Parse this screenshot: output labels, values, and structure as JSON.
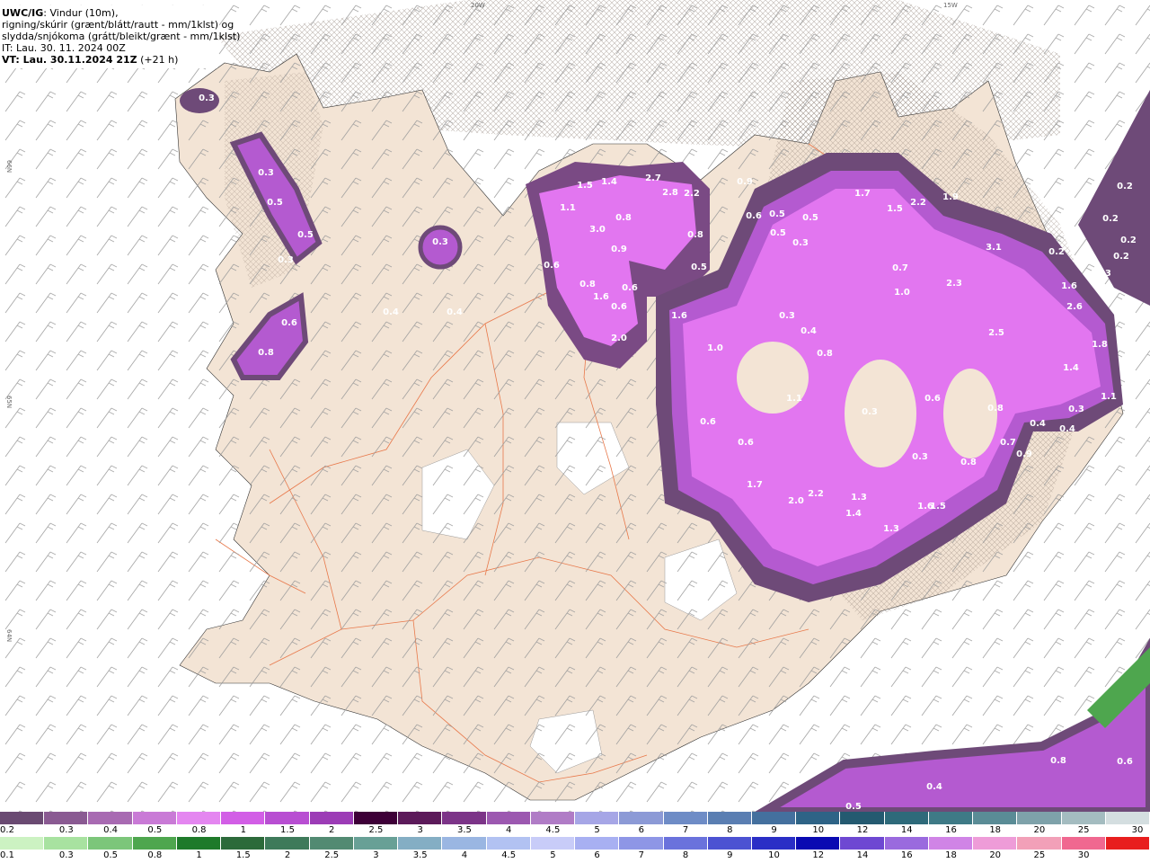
{
  "header": {
    "model": "UWC/IG",
    "desc1": ": Vindur (10m),",
    "desc2": "rigning/skúrir (grænt/blátt/rautt - mm/1klst) og",
    "desc3": "slydda/snjókoma (grátt/bleikt/grænt - mm/1klst)",
    "it": "IT: Lau. 30. 11. 2024 00Z",
    "vt_main": "VT: Lau. 30.11.2024 21Z",
    "vt_offset": "(+21 h)"
  },
  "map": {
    "grid_labels": [
      "20W",
      "15W",
      "66N",
      "65N",
      "64N"
    ],
    "precip_labels": [
      "0.3",
      "0.3",
      "0.5",
      "0.5",
      "0.3",
      "0.3",
      "0.6",
      "0.8",
      "0.4",
      "0.4",
      "1.5",
      "1.4",
      "1.1",
      "3.0",
      "2.7",
      "2.8",
      "2.2",
      "0.8",
      "0.9",
      "0.8",
      "0.5",
      "0.6",
      "0.8",
      "1.6",
      "0.6",
      "0.6",
      "2.0",
      "0.9",
      "0.6",
      "0.5",
      "0.5",
      "0.5",
      "0.3",
      "1.7",
      "1.5",
      "2.2",
      "1.9",
      "0.7",
      "1.0",
      "2.3",
      "3.1",
      "2.5",
      "1.6",
      "2.6",
      "1.8",
      "1.4",
      "1.1",
      "0.3",
      "0.4",
      "0.4",
      "0.2",
      "0.2",
      "0.2",
      "0.2",
      "0.2",
      "0.3",
      "1.6",
      "1.0",
      "0.3",
      "0.4",
      "0.8",
      "1.1",
      "0.6",
      "0.6",
      "0.3",
      "0.6",
      "0.8",
      "0.7",
      "0.8",
      "0.9",
      "0.3",
      "1.7",
      "2.0",
      "2.2",
      "1.3",
      "1.4",
      "1.6",
      "1.5",
      "1.3",
      "0.8",
      "0.6",
      "0.4",
      "0.5"
    ]
  },
  "colors": {
    "sea": "#ffffff",
    "land": "#f3e4d5",
    "roads": "#e8784a",
    "wind_barbs": "#9a9a9a",
    "snow_base": "#6e4a78",
    "snow_mid": "#b45ad0",
    "snow_high": "#e276f0"
  },
  "legend": {
    "snow_labels": [
      "0.2",
      "0.3",
      "0.4",
      "0.5",
      "0.8",
      "1",
      "1.5",
      "2",
      "2.5",
      "3",
      "3.5",
      "4",
      "4.5",
      "5",
      "6",
      "7",
      "8",
      "9",
      "10",
      "12",
      "14",
      "16",
      "18",
      "20",
      "25",
      "30"
    ],
    "snow_colors": [
      "#6a4a72",
      "#8a5a92",
      "#a86ab2",
      "#c97ad6",
      "#e486f0",
      "#d25ee6",
      "#b84ed2",
      "#9c3cb6",
      "#3e0038",
      "#5c1a5a",
      "#7c3488",
      "#9c58b0",
      "#b07cc6",
      "#a6a6e6",
      "#8c9ad6",
      "#6e8cc6",
      "#5a7eb2",
      "#44709e",
      "#2e6386",
      "#245a70",
      "#2e6a7a",
      "#3e7a86",
      "#5a8c96",
      "#7ea2aa",
      "#a4bcc0",
      "#d4dee0"
    ],
    "rain_labels": [
      "0.1",
      "0.3",
      "0.5",
      "0.8",
      "1",
      "1.5",
      "2",
      "2.5",
      "3",
      "3.5",
      "4",
      "4.5",
      "5",
      "6",
      "7",
      "8",
      "9",
      "10",
      "12",
      "14",
      "16",
      "18",
      "20",
      "25",
      "30"
    ],
    "rain_colors": [
      "#ccf2c2",
      "#a8e2a0",
      "#7cc67a",
      "#4ea64e",
      "#1e7a2a",
      "#2c6a3a",
      "#3e7a5a",
      "#528a72",
      "#68a096",
      "#84aec4",
      "#9ab6e2",
      "#b2c2f2",
      "#c8ccf8",
      "#a8b0f2",
      "#8e96e6",
      "#6a72dc",
      "#4c52d2",
      "#2a2ec6",
      "#0a0ab2",
      "#6e48d2",
      "#9a6ade",
      "#d084e6",
      "#ee9cd8",
      "#f2a0b8",
      "#f06890",
      "#e81e1e"
    ]
  }
}
